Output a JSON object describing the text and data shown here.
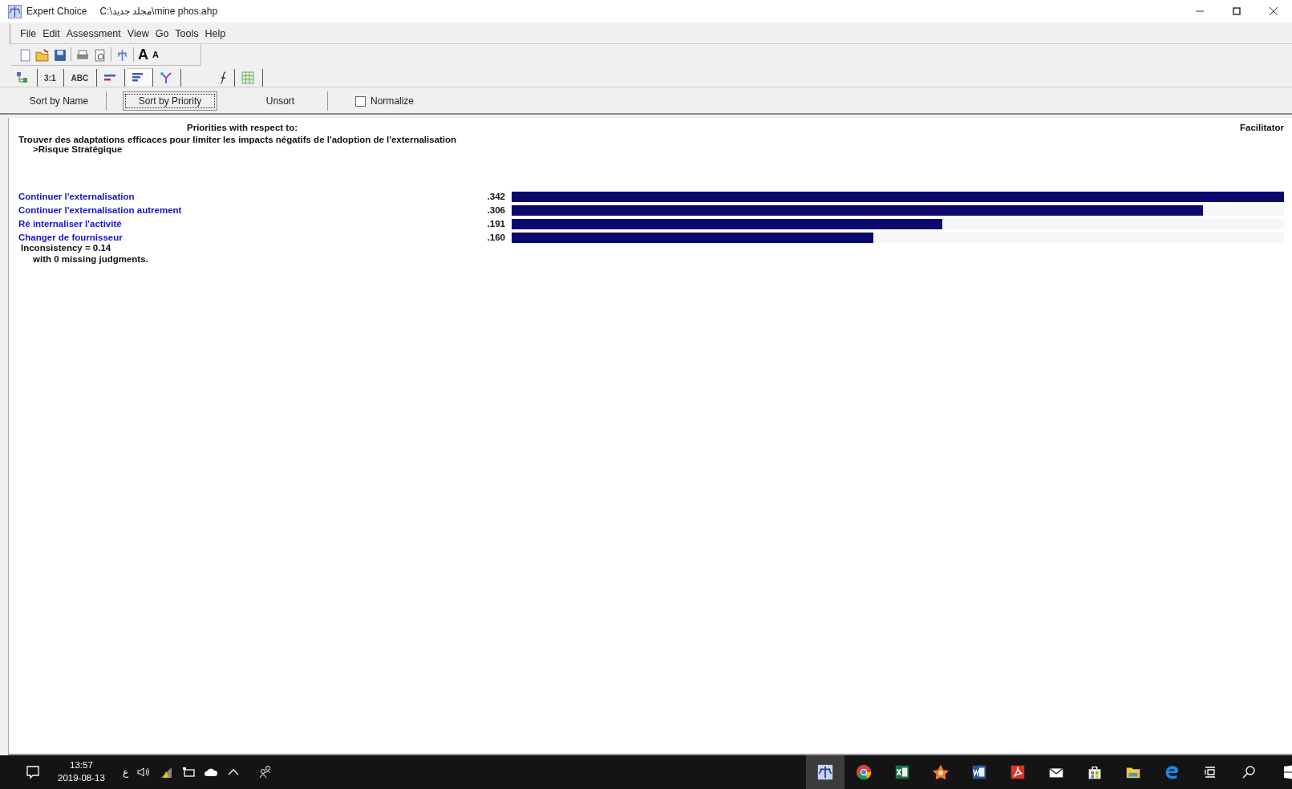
{
  "window": {
    "app_name": "Expert Choice",
    "file_path": "C:\\مجلد جديد\\mine phos.ahp"
  },
  "menu": [
    "File",
    "Edit",
    "Assessment",
    "View",
    "Go",
    "Tools",
    "Help"
  ],
  "font_buttons": [
    "A",
    "A"
  ],
  "tabs": [
    {
      "kind": "icon",
      "selected": false
    },
    {
      "kind": "text",
      "label": "3:1",
      "selected": false
    },
    {
      "kind": "text",
      "label": "ABC",
      "selected": false
    },
    {
      "kind": "icon",
      "selected": false
    },
    {
      "kind": "icon",
      "selected": true
    },
    {
      "kind": "icon",
      "selected": false
    },
    {
      "kind": "icon",
      "selected": false
    },
    {
      "kind": "icon",
      "selected": false
    }
  ],
  "sort_buttons": [
    {
      "label": "Sort by Name",
      "focused": false
    },
    {
      "label": "Sort by Priority",
      "focused": true
    },
    {
      "label": "Unsort",
      "focused": false
    }
  ],
  "normalize": {
    "label": "Normalize",
    "checked": false
  },
  "report": {
    "heading": "Priorities with respect to:",
    "role": "Facilitator",
    "goal": "Trouver des adaptations efficaces pour limiter les impacts négatifs de l'adoption de l'externalisation",
    "node": ">Risque Stratégique",
    "alternatives": [
      {
        "name": "Continuer l'externalisation",
        "value": ".342",
        "level": 1.0
      },
      {
        "name": "Continuer l'externalisation autrement",
        "value": ".306",
        "level": 0.895
      },
      {
        "name": "Ré internaliser l'activité",
        "value": ".191",
        "level": 0.558
      },
      {
        "name": "Changer de fournisseur",
        "value": ".160",
        "level": 0.468
      }
    ],
    "inconsistency": "Inconsistency = 0.14",
    "missing": "with 0  missing judgments."
  },
  "taskbar": {
    "time": "13:57",
    "date": "2019-08-13",
    "language": "ع",
    "apps": [
      {
        "selected": true
      },
      {
        "selected": false
      },
      {
        "selected": false
      },
      {
        "selected": false
      },
      {
        "selected": false
      },
      {
        "selected": false
      },
      {
        "selected": false
      },
      {
        "selected": false
      },
      {
        "selected": false
      },
      {
        "selected": false
      }
    ]
  }
}
